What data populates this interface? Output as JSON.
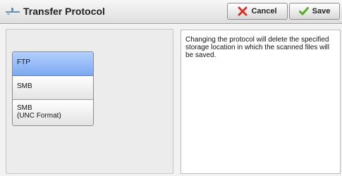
{
  "header": {
    "title": "Transfer Protocol",
    "cancel_label": "Cancel",
    "save_label": "Save"
  },
  "options": [
    {
      "line1": "FTP",
      "line2": "",
      "selected": true
    },
    {
      "line1": "SMB",
      "line2": "",
      "selected": false
    },
    {
      "line1": "SMB",
      "line2": "(UNC Format)",
      "selected": false
    }
  ],
  "message": "Changing the protocol will delete the specified storage location in which the scanned files will be saved.",
  "colors": {
    "selected_option": "#8fb5f5",
    "cancel_icon": "#d9342b",
    "save_icon": "#5aaa2a"
  }
}
